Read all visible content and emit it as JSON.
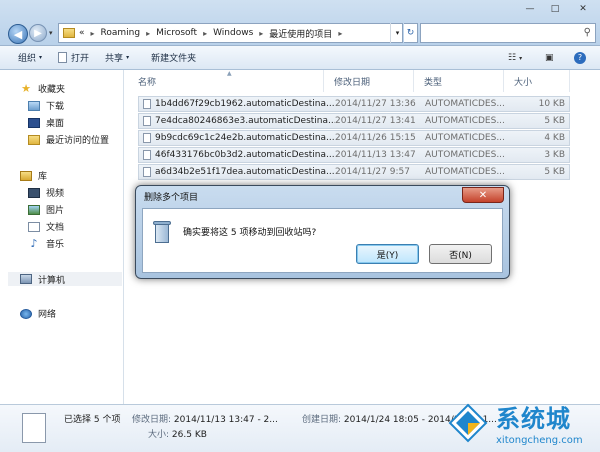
{
  "window": {
    "minimize": "—",
    "maximize": "□",
    "close": "✕"
  },
  "address": {
    "prefix": "«",
    "crumbs": [
      "Roaming",
      "Microsoft",
      "Windows",
      "最近使用的项目"
    ],
    "separator": "▸"
  },
  "toolbar": {
    "organize": "组织",
    "open": "打开",
    "share": "共享",
    "new_folder": "新建文件夹",
    "caret": "▾"
  },
  "nav": {
    "favorites": "收藏夹",
    "downloads": "下载",
    "desktop": "桌面",
    "recent": "最近访问的位置",
    "libraries": "库",
    "videos": "视频",
    "pictures": "图片",
    "documents": "文档",
    "music": "音乐",
    "computer": "计算机",
    "network": "网络"
  },
  "columns": {
    "name": "名称",
    "date": "修改日期",
    "type": "类型",
    "size": "大小"
  },
  "files": [
    {
      "name": "1b4dd67f29cb1962.automaticDestina...",
      "date": "2014/11/27 13:36",
      "type": "AUTOMATICDES...",
      "size": "10 KB"
    },
    {
      "name": "7e4dca80246863e3.automaticDestina...",
      "date": "2014/11/27 13:41",
      "type": "AUTOMATICDES...",
      "size": "5 KB"
    },
    {
      "name": "9b9cdc69c1c24e2b.automaticDestina...",
      "date": "2014/11/26 15:15",
      "type": "AUTOMATICDES...",
      "size": "4 KB"
    },
    {
      "name": "46f433176bc0b3d2.automaticDestina...",
      "date": "2014/11/13 13:47",
      "type": "AUTOMATICDES...",
      "size": "3 KB"
    },
    {
      "name": "a6d34b2e51f17dea.automaticDestina...",
      "date": "2014/11/27 9:57",
      "type": "AUTOMATICDES...",
      "size": "5 KB"
    }
  ],
  "dialog": {
    "title": "删除多个项目",
    "close": "✕",
    "message": "确实要将这 5 项移动到回收站吗?",
    "yes": "是(Y)",
    "no": "否(N)"
  },
  "details": {
    "selected": "已选择 5 个项",
    "modified_label": "修改日期:",
    "modified_value": "2014/11/13 13:47 - 2...",
    "created_label": "创建日期:",
    "created_value": "2014/1/24 18:05 - 2014/11/25 1...",
    "size_label": "大小:",
    "size_value": "26.5 KB"
  },
  "watermark": {
    "text": "系统城",
    "url": "xitongcheng.com"
  }
}
